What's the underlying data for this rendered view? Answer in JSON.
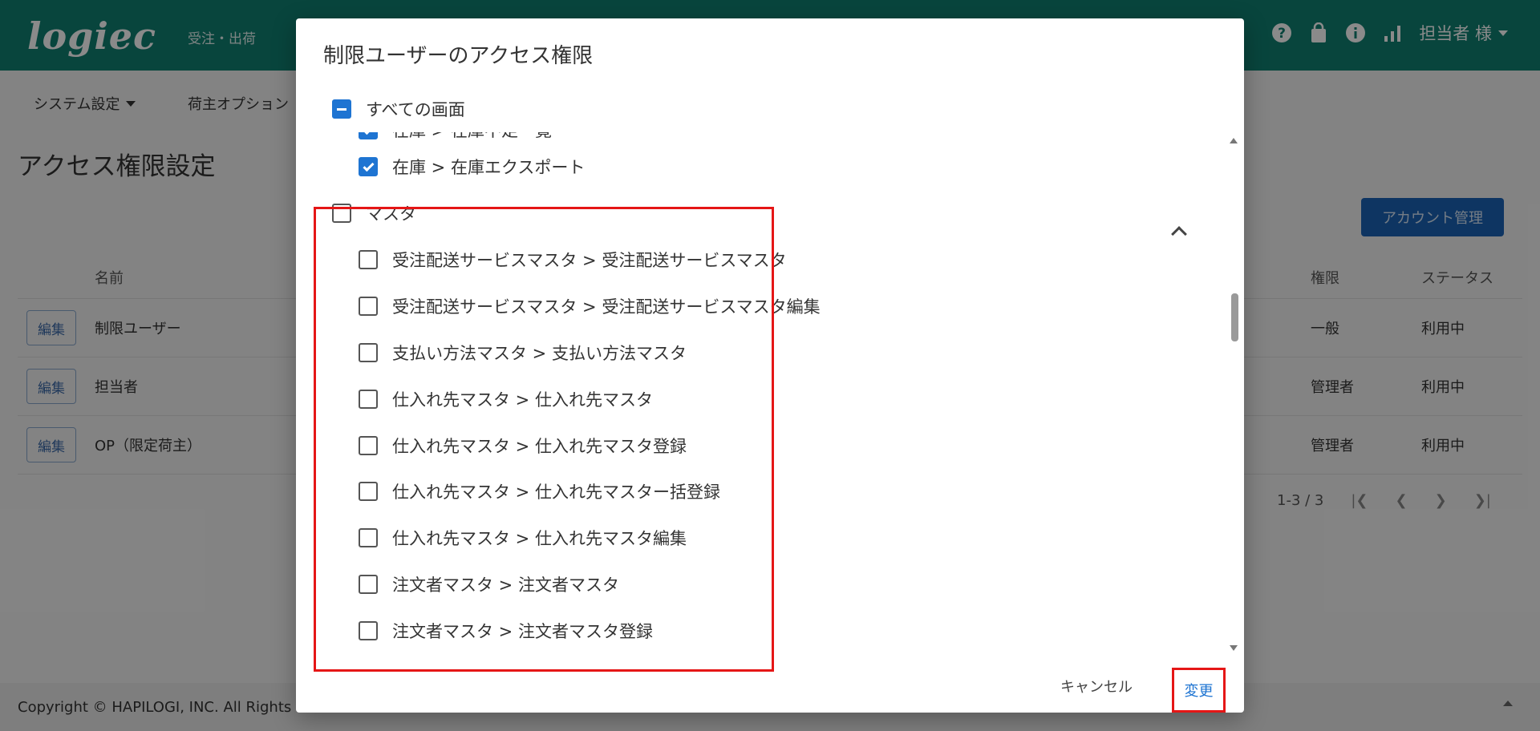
{
  "appbar": {
    "logo": "logiec",
    "nav_item": "受注・出荷",
    "user_label": "担当者 様",
    "icons": [
      "help-icon",
      "shopping-bag-icon",
      "info-icon",
      "bar-chart-icon"
    ]
  },
  "subnav": {
    "items": [
      "システム設定",
      "荷主オプション"
    ]
  },
  "page": {
    "title": "アクセス権限設定",
    "account_button": "アカウント管理"
  },
  "table": {
    "columns": {
      "name": "名前",
      "role": "権限",
      "status": "ステータス"
    },
    "edit_label": "編集",
    "rows": [
      {
        "name": "制限ユーザー",
        "role": "一般",
        "status": "利用中"
      },
      {
        "name": "担当者",
        "role": "管理者",
        "status": "利用中"
      },
      {
        "name": "OP（限定荷主）",
        "role": "管理者",
        "status": "利用中"
      }
    ],
    "pagination": "1-3 / 3"
  },
  "footer": {
    "copyright": "Copyright © HAPILOGI, INC. All Rights"
  },
  "dialog": {
    "title": "制限ユーザーのアクセス権限",
    "all_label": "すべての画面",
    "items_top": [
      {
        "label": "在庫 > 在庫不足一覧",
        "checked": true
      },
      {
        "label": "在庫 > 在庫エクスポート",
        "checked": true
      }
    ],
    "group": {
      "label": "マスタ",
      "checked": false,
      "expanded": true
    },
    "group_items": [
      {
        "label": "受注配送サービスマスタ > 受注配送サービスマスタ",
        "checked": false
      },
      {
        "label": "受注配送サービスマスタ > 受注配送サービスマスタ編集",
        "checked": false
      },
      {
        "label": "支払い方法マスタ > 支払い方法マスタ",
        "checked": false
      },
      {
        "label": "仕入れ先マスタ > 仕入れ先マスタ",
        "checked": false
      },
      {
        "label": "仕入れ先マスタ > 仕入れ先マスタ登録",
        "checked": false
      },
      {
        "label": "仕入れ先マスタ > 仕入れ先マスター括登録",
        "checked": false
      },
      {
        "label": "仕入れ先マスタ > 仕入れ先マスタ編集",
        "checked": false
      },
      {
        "label": "注文者マスタ > 注文者マスタ",
        "checked": false
      },
      {
        "label": "注文者マスタ > 注文者マスタ登録",
        "checked": false
      }
    ],
    "cancel_label": "キャンセル",
    "change_label": "変更"
  },
  "colors": {
    "appbar": "#0f8072",
    "primary": "#1e74d2",
    "highlight": "#e51616"
  }
}
